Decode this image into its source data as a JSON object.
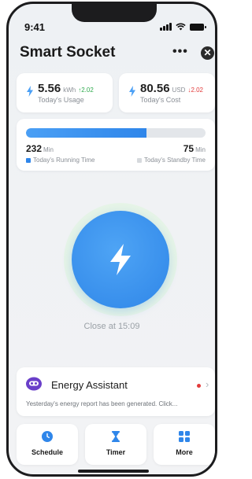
{
  "status_bar": {
    "time": "9:41",
    "icons": [
      "signal-icon",
      "wifi-icon",
      "battery-icon"
    ]
  },
  "header": {
    "title": "Smart Socket",
    "more_label": "•••",
    "close_label": "✕"
  },
  "usage": {
    "value": "5.56",
    "unit": "kWh",
    "delta": "↑2.02",
    "label": "Today's Usage",
    "delta_color": "#2eaa4d"
  },
  "cost": {
    "value": "80.56",
    "unit": "USD",
    "delta": "↓2.02",
    "label": "Today's Cost",
    "delta_color": "#e23b3b"
  },
  "time_card": {
    "running_value": "232",
    "running_unit": "Min",
    "running_label": "Today's Running Time",
    "standby_value": "75",
    "standby_unit": "Min",
    "standby_label": "Today's Standby Time",
    "running_fraction": 0.67,
    "running_color": "#2f86ea",
    "standby_color": "#e3e6ea"
  },
  "power": {
    "icon": "lightning-bolt-icon",
    "close_at": "Close at 15:09"
  },
  "assistant": {
    "title": "Energy Assistant",
    "description": "Yesterday's energy report has been generated. Click...",
    "chevron": "›"
  },
  "tiles": [
    {
      "label": "Schedule",
      "icon": "clock-icon"
    },
    {
      "label": "Timer",
      "icon": "hourglass-icon"
    },
    {
      "label": "More",
      "icon": "grid-icon"
    }
  ],
  "colors": {
    "accent": "#2f86ea",
    "halo": "#e6f4e7",
    "background": "#eef1f4"
  }
}
